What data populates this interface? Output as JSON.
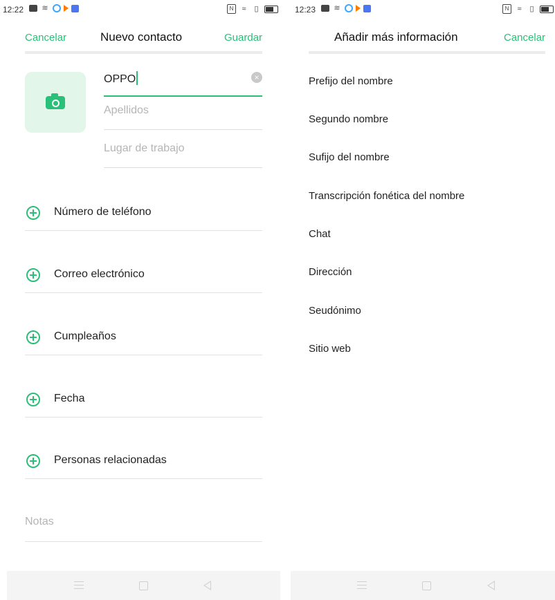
{
  "left": {
    "status": {
      "time": "12:22"
    },
    "header": {
      "cancel": "Cancelar",
      "title": "Nuevo contacto",
      "save": "Guardar"
    },
    "form": {
      "first_name_value": "OPPO",
      "last_name_placeholder": "Apellidos",
      "workplace_placeholder": "Lugar de trabajo"
    },
    "rows": [
      {
        "label": "Número de teléfono"
      },
      {
        "label": "Correo electrónico"
      },
      {
        "label": "Cumpleaños"
      },
      {
        "label": "Fecha"
      },
      {
        "label": "Personas relacionadas"
      }
    ],
    "notes_placeholder": "Notas"
  },
  "right": {
    "status": {
      "time": "12:23"
    },
    "header": {
      "title": "Añadir más información",
      "cancel": "Cancelar"
    },
    "options": [
      {
        "label": "Prefijo del nombre"
      },
      {
        "label": "Segundo nombre"
      },
      {
        "label": "Sufijo del nombre"
      },
      {
        "label": "Transcripción fonética del nombre"
      },
      {
        "label": "Chat"
      },
      {
        "label": "Dirección"
      },
      {
        "label": "Seudónimo"
      },
      {
        "label": "Sitio web"
      }
    ]
  },
  "colors": {
    "accent": "#2bbf76",
    "avatar_bg": "#e2f7ea",
    "divider": "#ececec"
  },
  "icons": [
    "camera-icon",
    "clear-icon",
    "add-circle-icon",
    "wifi-icon",
    "battery-icon",
    "nfc-icon",
    "vibrate-icon"
  ]
}
